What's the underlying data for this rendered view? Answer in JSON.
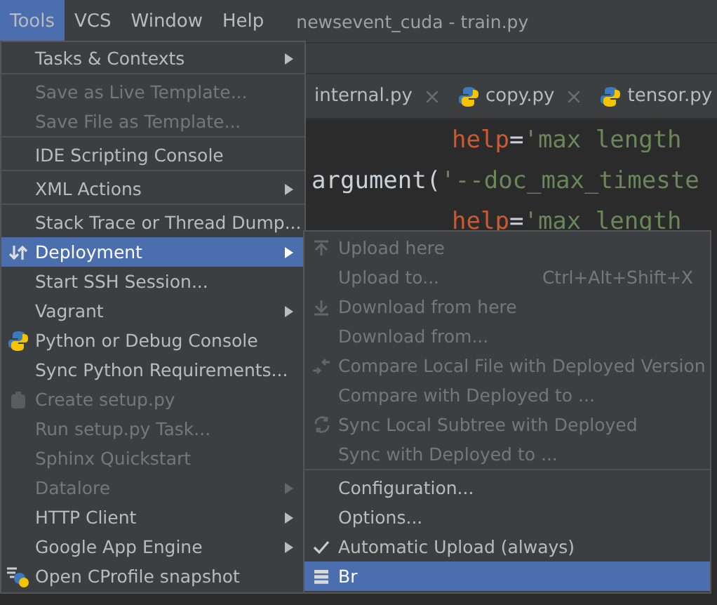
{
  "menubar": {
    "items": [
      {
        "label": "Tools",
        "selected": true
      },
      {
        "label": "VCS",
        "selected": false
      },
      {
        "label": "Window",
        "selected": false
      },
      {
        "label": "Help",
        "selected": false
      }
    ],
    "title": "newsevent_cuda - train.py"
  },
  "tabs": [
    {
      "label": "internal.py"
    },
    {
      "label": "copy.py"
    },
    {
      "label": "tensor.py"
    }
  ],
  "code": [
    {
      "kind": "continuation",
      "tokens": [
        {
          "kind": "param",
          "text": "help"
        },
        {
          "kind": "plain",
          "text": "="
        },
        {
          "kind": "string",
          "text": "'max length"
        }
      ]
    },
    {
      "kind": "call",
      "tokens": [
        {
          "kind": "plain",
          "text": "argument("
        },
        {
          "kind": "string",
          "text": "'--doc_max_timeste"
        }
      ]
    },
    {
      "kind": "continuation",
      "tokens": [
        {
          "kind": "param",
          "text": "help"
        },
        {
          "kind": "plain",
          "text": "="
        },
        {
          "kind": "string",
          "text": "'max length"
        }
      ]
    }
  ],
  "tools_menu": [
    {
      "label": "Tasks & Contexts",
      "disabled": false,
      "submenu": true,
      "selected": false,
      "separator_after": true
    },
    {
      "label": "Save as Live Template...",
      "disabled": true,
      "submenu": false,
      "selected": false
    },
    {
      "label": "Save File as Template...",
      "disabled": true,
      "submenu": false,
      "selected": false,
      "separator_after": true
    },
    {
      "label": "IDE Scripting Console",
      "disabled": false,
      "submenu": false,
      "selected": false,
      "separator_after": true
    },
    {
      "label": "XML Actions",
      "disabled": false,
      "submenu": true,
      "selected": false,
      "separator_after": true
    },
    {
      "label": "Stack Trace or Thread Dump...",
      "disabled": false,
      "submenu": false,
      "selected": false
    },
    {
      "label": "Deployment",
      "disabled": false,
      "submenu": true,
      "selected": true
    },
    {
      "label": "Start SSH Session...",
      "disabled": false,
      "submenu": false,
      "selected": false
    },
    {
      "label": "Vagrant",
      "disabled": false,
      "submenu": true,
      "selected": false
    },
    {
      "label": "Python or Debug Console",
      "disabled": false,
      "submenu": false,
      "selected": false
    },
    {
      "label": "Sync Python Requirements...",
      "disabled": false,
      "submenu": false,
      "selected": false
    },
    {
      "label": "Create setup.py",
      "disabled": true,
      "submenu": false,
      "selected": false
    },
    {
      "label": "Run setup.py Task...",
      "disabled": true,
      "submenu": false,
      "selected": false
    },
    {
      "label": "Sphinx Quickstart",
      "disabled": true,
      "submenu": false,
      "selected": false
    },
    {
      "label": "Datalore",
      "disabled": true,
      "submenu": true,
      "selected": false
    },
    {
      "label": "HTTP Client",
      "disabled": false,
      "submenu": true,
      "selected": false
    },
    {
      "label": "Google App Engine",
      "disabled": false,
      "submenu": true,
      "selected": false
    },
    {
      "label": "Open CProfile snapshot",
      "disabled": false,
      "submenu": false,
      "selected": false
    }
  ],
  "deployment_menu": [
    {
      "label": "Upload here",
      "disabled": true,
      "checked": false,
      "selected": false
    },
    {
      "label": "Upload to...",
      "shortcut": "Ctrl+Alt+Shift+X",
      "disabled": true,
      "checked": false,
      "selected": false
    },
    {
      "label": "Download from here",
      "disabled": true,
      "checked": false,
      "selected": false
    },
    {
      "label": "Download from...",
      "disabled": true,
      "checked": false,
      "selected": false
    },
    {
      "label": "Compare Local File with Deployed Version",
      "disabled": true,
      "checked": false,
      "selected": false
    },
    {
      "label": "Compare with Deployed to ...",
      "disabled": true,
      "checked": false,
      "selected": false
    },
    {
      "label": "Sync Local Subtree with Deployed",
      "disabled": true,
      "checked": false,
      "selected": false
    },
    {
      "label": "Sync with Deployed to ...",
      "disabled": true,
      "checked": false,
      "selected": false,
      "separator_after": true
    },
    {
      "label": "Configuration...",
      "disabled": false,
      "checked": false,
      "selected": false
    },
    {
      "label": "Options...",
      "disabled": false,
      "checked": false,
      "selected": false
    },
    {
      "label": "Automatic Upload (always)",
      "disabled": false,
      "checked": true,
      "selected": false
    },
    {
      "label": "Br",
      "disabled": false,
      "checked": false,
      "selected": true
    }
  ]
}
